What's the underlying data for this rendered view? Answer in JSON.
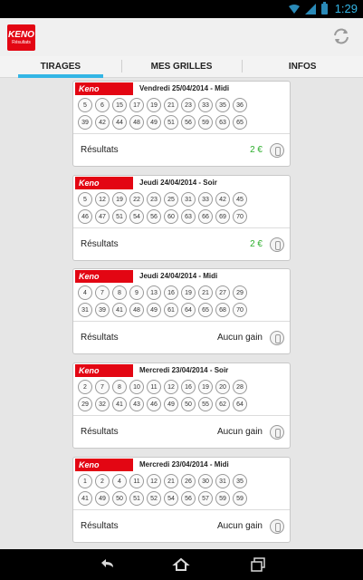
{
  "status_bar": {
    "time": "1:29"
  },
  "app": {
    "logo": {
      "line1": "KENO",
      "line2": "Résultats"
    },
    "refresh_icon": "refresh-icon"
  },
  "tabs": [
    {
      "label": "TIRAGES",
      "active": true
    },
    {
      "label": "MES GRILLES",
      "active": false
    },
    {
      "label": "INFOS",
      "active": false
    }
  ],
  "draws": [
    {
      "badge": "Keno",
      "title": "Vendredi 25/04/2014 - Midi",
      "numbers_row1": [
        "5",
        "6",
        "15",
        "17",
        "19",
        "21",
        "23",
        "33",
        "35",
        "36"
      ],
      "numbers_row2": [
        "39",
        "42",
        "44",
        "48",
        "49",
        "51",
        "56",
        "59",
        "63",
        "65"
      ],
      "result_label": "Résultats",
      "result_value": "2 €",
      "won": true
    },
    {
      "badge": "Keno",
      "title": "Jeudi 24/04/2014 - Soir",
      "numbers_row1": [
        "5",
        "12",
        "19",
        "22",
        "23",
        "25",
        "31",
        "33",
        "42",
        "45"
      ],
      "numbers_row2": [
        "46",
        "47",
        "51",
        "54",
        "56",
        "60",
        "63",
        "66",
        "69",
        "70"
      ],
      "result_label": "Résultats",
      "result_value": "2 €",
      "won": true
    },
    {
      "badge": "Keno",
      "title": "Jeudi 24/04/2014 - Midi",
      "numbers_row1": [
        "4",
        "7",
        "8",
        "9",
        "13",
        "16",
        "19",
        "21",
        "27",
        "29"
      ],
      "numbers_row2": [
        "31",
        "39",
        "41",
        "48",
        "49",
        "61",
        "64",
        "65",
        "68",
        "70"
      ],
      "result_label": "Résultats",
      "result_value": "Aucun gain",
      "won": false
    },
    {
      "badge": "Keno",
      "title": "Mercredi 23/04/2014 - Soir",
      "numbers_row1": [
        "2",
        "7",
        "8",
        "10",
        "11",
        "12",
        "16",
        "19",
        "20",
        "28"
      ],
      "numbers_row2": [
        "29",
        "32",
        "41",
        "43",
        "46",
        "49",
        "50",
        "55",
        "62",
        "64"
      ],
      "result_label": "Résultats",
      "result_value": "Aucun gain",
      "won": false
    },
    {
      "badge": "Keno",
      "title": "Mercredi 23/04/2014 - Midi",
      "numbers_row1": [
        "1",
        "2",
        "4",
        "11",
        "12",
        "21",
        "26",
        "30",
        "31",
        "35"
      ],
      "numbers_row2": [
        "41",
        "49",
        "50",
        "51",
        "52",
        "54",
        "56",
        "57",
        "59",
        "59"
      ],
      "result_label": "Résultats",
      "result_value": "Aucun gain",
      "won": false
    }
  ],
  "colors": {
    "brand_red": "#e30613",
    "accent_blue": "#33b5e5",
    "win_green": "#2cae2c"
  }
}
